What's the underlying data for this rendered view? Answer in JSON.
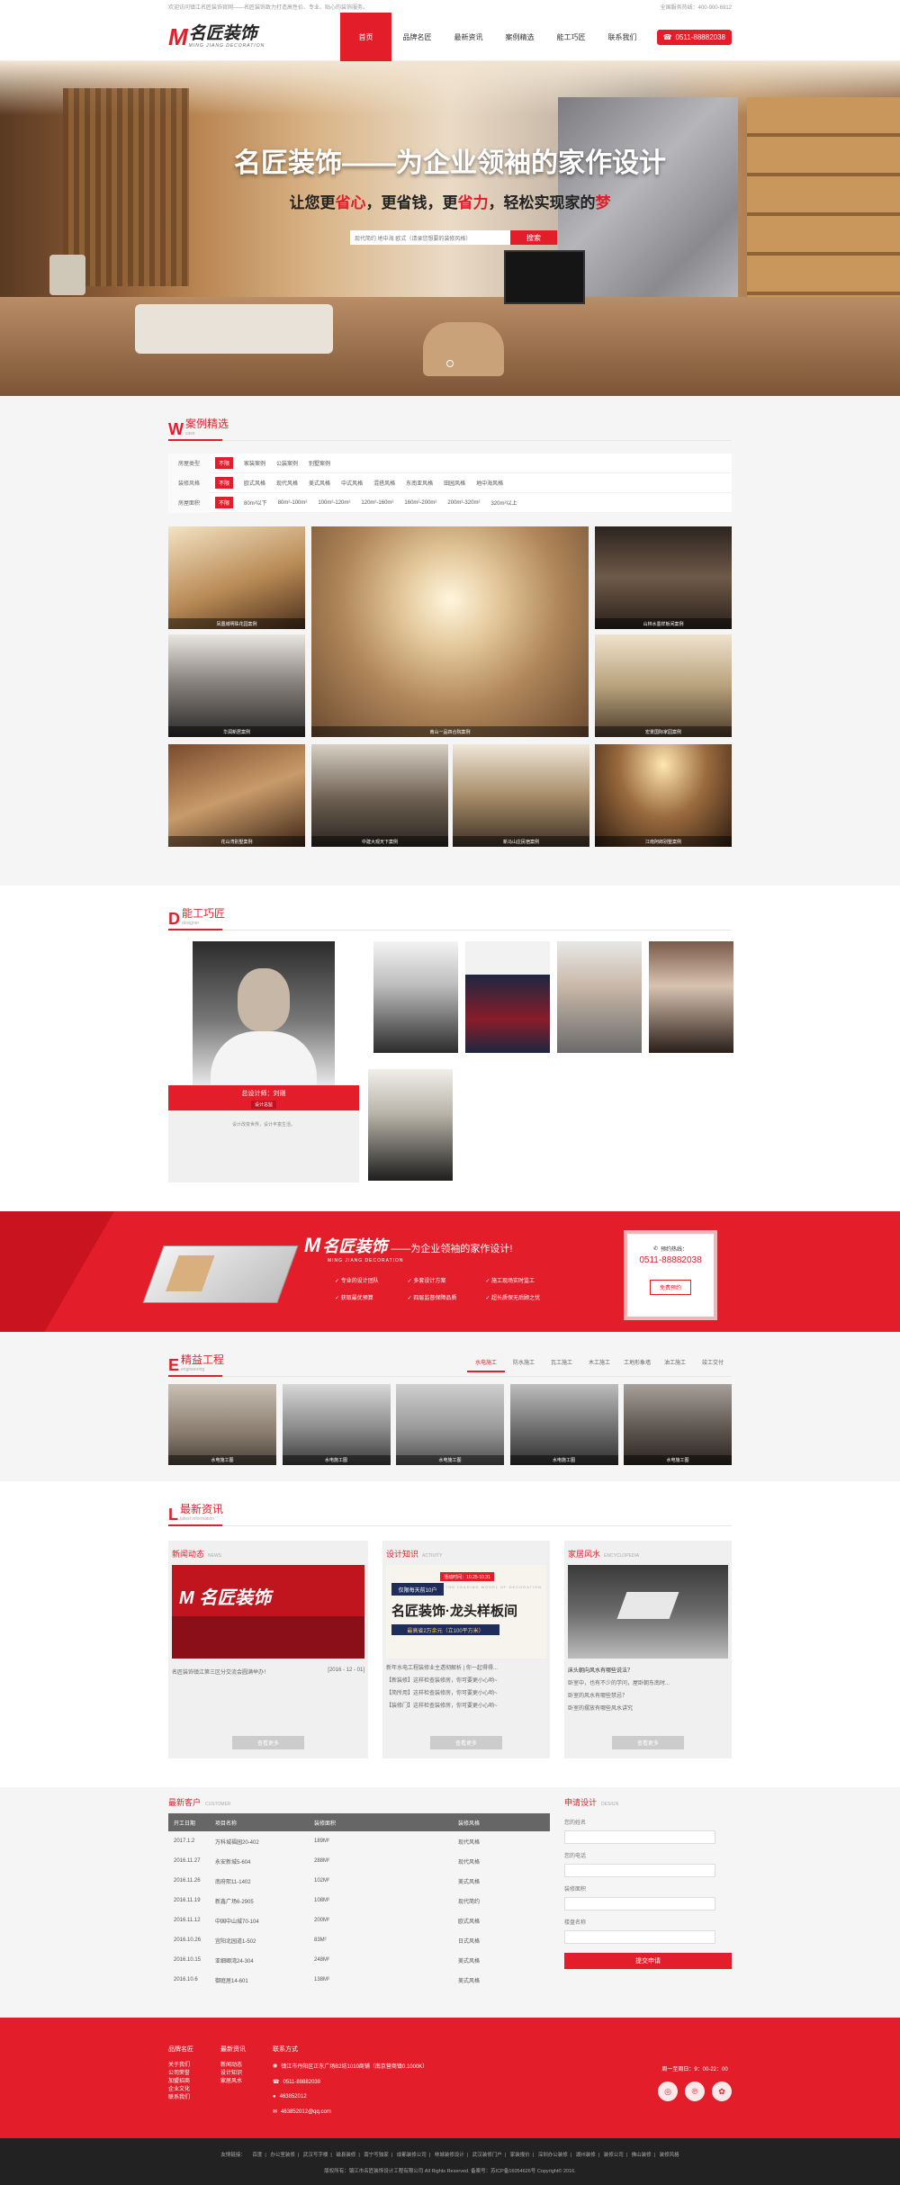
{
  "topbar": {
    "left": "欢迎访问镇江名匠装饰官网——名匠装饰致力打造高性价、专业、贴心的装饰服务。",
    "right": "全国服务热线：400-900-6912"
  },
  "brand": {
    "mark": "M",
    "name": "名匠装饰",
    "en": "MING JIANG DECORATION",
    "accent": "#e31d2a"
  },
  "nav": {
    "items": [
      "首页",
      "品牌名匠",
      "最新资讯",
      "案例精选",
      "能工巧匠",
      "联系我们"
    ],
    "phone": "0511-88882038"
  },
  "banner": {
    "title": "名匠装饰——为企业领袖的家作设计",
    "sub_1": "让您更",
    "sub_2": "省心",
    "sub_3": "，更省钱，更",
    "sub_4": "省力",
    "sub_5": "，轻松实现家的",
    "sub_6": "梦",
    "search_placeholder": "现代简约 地中海 欧式（请录您想要的装修风格）",
    "search_button": "搜索"
  },
  "cases": {
    "letter": "W",
    "title": "案例精选",
    "en": "case",
    "filters": [
      {
        "label": "房屋类型",
        "options": [
          "不限",
          "家装案例",
          "公装案例",
          "别墅案例"
        ]
      },
      {
        "label": "装修风格",
        "options": [
          "不限",
          "欧式风格",
          "现代风格",
          "美式风格",
          "中式风格",
          "混搭风格",
          "东南亚风格",
          "田园风格",
          "地中海风格"
        ]
      },
      {
        "label": "房屋面积",
        "options": [
          "不限",
          "80m²以下",
          "80m²-100m²",
          "100m²-120m²",
          "120m²-160m²",
          "160m²-200m²",
          "200m²-320m²",
          "320m²以上"
        ]
      }
    ],
    "items": [
      {
        "caption": "凤凰城明珠花园案例"
      },
      {
        "caption": "南山一品四合院案例"
      },
      {
        "caption": "山林水墨样板间案例"
      },
      {
        "caption": "华润新居案例"
      },
      {
        "caption": "宏景国际家园案例"
      },
      {
        "caption": "花山湾别墅案例"
      },
      {
        "caption": "中建大观天下案例"
      },
      {
        "caption": "新马山庄民宿案例"
      },
      {
        "caption": "江南阿郎别墅案例"
      }
    ]
  },
  "designers": {
    "letter": "D",
    "title": "能工巧匠",
    "en": "designer",
    "featured_name": "总设计师：刘刚",
    "featured_tag": "设计总监",
    "featured_desc": "设计改变世界，设计丰富生活。"
  },
  "promo": {
    "name": "名匠装饰",
    "mark": "M",
    "en": "MING JIANG DECORATION",
    "slogan": "——为企业领袖的家作设计!",
    "features": [
      "专业的设计团队",
      "多套设计方案",
      "施工现场实时监工",
      "获取最优预算",
      "四层监督保障品质",
      "超长质保无后顾之忧"
    ],
    "call_label": "预约热线：",
    "call_number": "0511-88882038",
    "call_button": "免费预约"
  },
  "projects": {
    "letter": "E",
    "title": "精益工程",
    "en": "engineering",
    "tabs": [
      "水电施工",
      "防水施工",
      "瓦工施工",
      "木工施工",
      "工地形象墙",
      "油工施工",
      "竣工交付"
    ],
    "items": [
      "水电施工图",
      "水电施工图",
      "水电施工图",
      "水电施工图",
      "水电施工图"
    ]
  },
  "news": {
    "letter": "L",
    "title": "最新资讯",
    "en": "latest information",
    "columns": [
      {
        "title": "新闻动态",
        "en": "NEWS",
        "headline": "名匠装饰镇江第三区分交流会圆满举办！",
        "date": "[2016 - 12 - 01]",
        "lines": [],
        "more": "查看更多"
      },
      {
        "title": "设计知识",
        "en": "ACTIVITY",
        "headline": "",
        "date": "",
        "lines": [
          "新年水电工程装修业主透彻解析 | 你一起得得...",
          "【新装修】这样检查装修房，你可要更小心哟~",
          "【简所用】这样检查装修房，你可要更小心哟~",
          "【装修门】这样检查装修房，你可要更小心哟~"
        ],
        "more": "查看更多",
        "pic_banner": "仅限每天前10户",
        "pic_brand": "名匠装饰·龙头样板间",
        "pic_en": "THE LEADING MODEL OF DECORATION",
        "pic_date": "活动时间：10.25-10.31",
        "pic_offer": "最高省2万余元（立100平方米）"
      },
      {
        "title": "家居风水",
        "en": "ENCYCLOPEDIA",
        "headline": "床头朝向风水有哪些说法？",
        "date": "",
        "lines": [
          "卧室中，也有不少的学问，屋卧朝东南时...",
          "卧室的风水有哪些禁忌？",
          "卧室的摆放有哪些风水讲究"
        ],
        "more": "查看更多"
      }
    ]
  },
  "clients": {
    "title": "最新客户",
    "en": "CUSTOMER",
    "headers": [
      "开工日期",
      "项目名称",
      "装修面积",
      "装修风格"
    ],
    "rows": [
      [
        "2017.1.2",
        "万科城福园20-402",
        "189M²",
        "现代风格"
      ],
      [
        "2016.11.27",
        "永安新城5-604",
        "288M²",
        "现代风格"
      ],
      [
        "2016.11.26",
        "南府熙11-1402",
        "102M²",
        "美式风格"
      ],
      [
        "2016.11.19",
        "新鑫广场6-2905",
        "108M²",
        "现代简约"
      ],
      [
        "2016.11.12",
        "中国中山城70-104",
        "200M²",
        "欧式风格"
      ],
      [
        "2016.10.26",
        "宜阳北园道1-502",
        "83M²",
        "日式风格"
      ],
      [
        "2016.10.15",
        "亚细卿湾24-304",
        "248M²",
        "美式风格"
      ],
      [
        "2016.10.6",
        "御庭居14-601",
        "138M²",
        "美式风格"
      ]
    ]
  },
  "apply": {
    "title": "申请设计",
    "en": "DESIGN",
    "fields": [
      "您的姓名",
      "您的电话",
      "装修面积",
      "楼盘名称"
    ],
    "button": "提交申请"
  },
  "footer": {
    "cols": [
      {
        "title": "品牌名匠",
        "links": [
          "关于我们",
          "公司荣誉",
          "加盟招商",
          "企业文化",
          "联系我们"
        ]
      },
      {
        "title": "最新资讯",
        "links": [
          "新闻动态",
          "设计知识",
          "家居风水"
        ]
      }
    ],
    "contact_title": "联系方式",
    "contact": [
      "镇江市丹阳区正东广场B2坊1010商铺（南京营商镇0.1000K）",
      "0511-88882038",
      "463852012",
      "463852012@qq.com"
    ],
    "hours": "周一至周日：9：00-22：00",
    "icons": [
      "weibo-icon",
      "pinterest-icon",
      "wechat-icon"
    ]
  },
  "bottom": {
    "links": [
      "友情链接：",
      "百度",
      "办公室装修",
      "武汉写字楼",
      "磁县装修",
      "南宁写独家",
      "成都装修公司",
      "林城装修设计",
      "武汉装修门户",
      "家装报价",
      "深圳办公装修",
      "湖州装修",
      "装修公司",
      "佛山装修",
      "装修风格"
    ],
    "copyright": "版权所有：镇江市名匠装饰设计工程有限公司 All Rights Reserved. 备案号：苏ICP备16054626号 Copyright© 2016."
  }
}
